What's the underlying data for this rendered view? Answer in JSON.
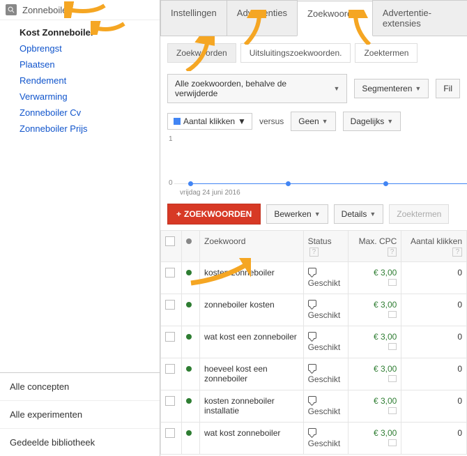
{
  "sidebar": {
    "search_label": "Zonneboiler",
    "items": [
      {
        "label": "Kost Zonneboiler",
        "bold": true
      },
      {
        "label": "Opbrengst"
      },
      {
        "label": "Plaatsen"
      },
      {
        "label": "Rendement"
      },
      {
        "label": "Verwarming"
      },
      {
        "label": "Zonneboiler Cv"
      },
      {
        "label": "Zonneboiler Prijs"
      }
    ],
    "bottom": [
      {
        "label": "Alle concepten"
      },
      {
        "label": "Alle experimenten"
      },
      {
        "label": "Gedeelde bibliotheek"
      }
    ]
  },
  "tabs": [
    {
      "label": "Instellingen"
    },
    {
      "label": "Advertenties"
    },
    {
      "label": "Zoekwoorden",
      "active": true
    },
    {
      "label": "Advertentie-extensies"
    }
  ],
  "subtabs": [
    {
      "label": "Zoekwoorden",
      "active": true
    },
    {
      "label": "Uitsluitingszoekwoorden."
    },
    {
      "label": "Zoektermen"
    }
  ],
  "toolbar1": {
    "filter": "Alle zoekwoorden, behalve de verwijderde",
    "segment": "Segmenteren",
    "fil": "Fil"
  },
  "toolbar2": {
    "metric": "Aantal klikken",
    "versus": "versus",
    "none": "Geen",
    "period": "Dagelijks"
  },
  "chart": {
    "y0": "0",
    "y1": "1",
    "date": "vrijdag 24 juni 2016"
  },
  "actions": {
    "add": "ZOEKWOORDEN",
    "edit": "Bewerken",
    "details": "Details",
    "terms": "Zoektermen"
  },
  "table": {
    "headers": {
      "keyword": "Zoekwoord",
      "status": "Status",
      "cpc": "Max. CPC",
      "clicks": "Aantal klikken"
    },
    "rows": [
      {
        "kw": "kosten zonneboiler",
        "status": "Geschikt",
        "cpc": "€ 3,00",
        "clicks": "0"
      },
      {
        "kw": "zonneboiler kosten",
        "status": "Geschikt",
        "cpc": "€ 3,00",
        "clicks": "0"
      },
      {
        "kw": "wat kost een zonneboiler",
        "status": "Geschikt",
        "cpc": "€ 3,00",
        "clicks": "0"
      },
      {
        "kw": "hoeveel kost een zonneboiler",
        "status": "Geschikt",
        "cpc": "€ 3,00",
        "clicks": "0"
      },
      {
        "kw": "kosten zonneboiler installatie",
        "status": "Geschikt",
        "cpc": "€ 3,00",
        "clicks": "0"
      },
      {
        "kw": "wat kost zonneboiler",
        "status": "Geschikt",
        "cpc": "€ 3,00",
        "clicks": "0"
      }
    ]
  }
}
